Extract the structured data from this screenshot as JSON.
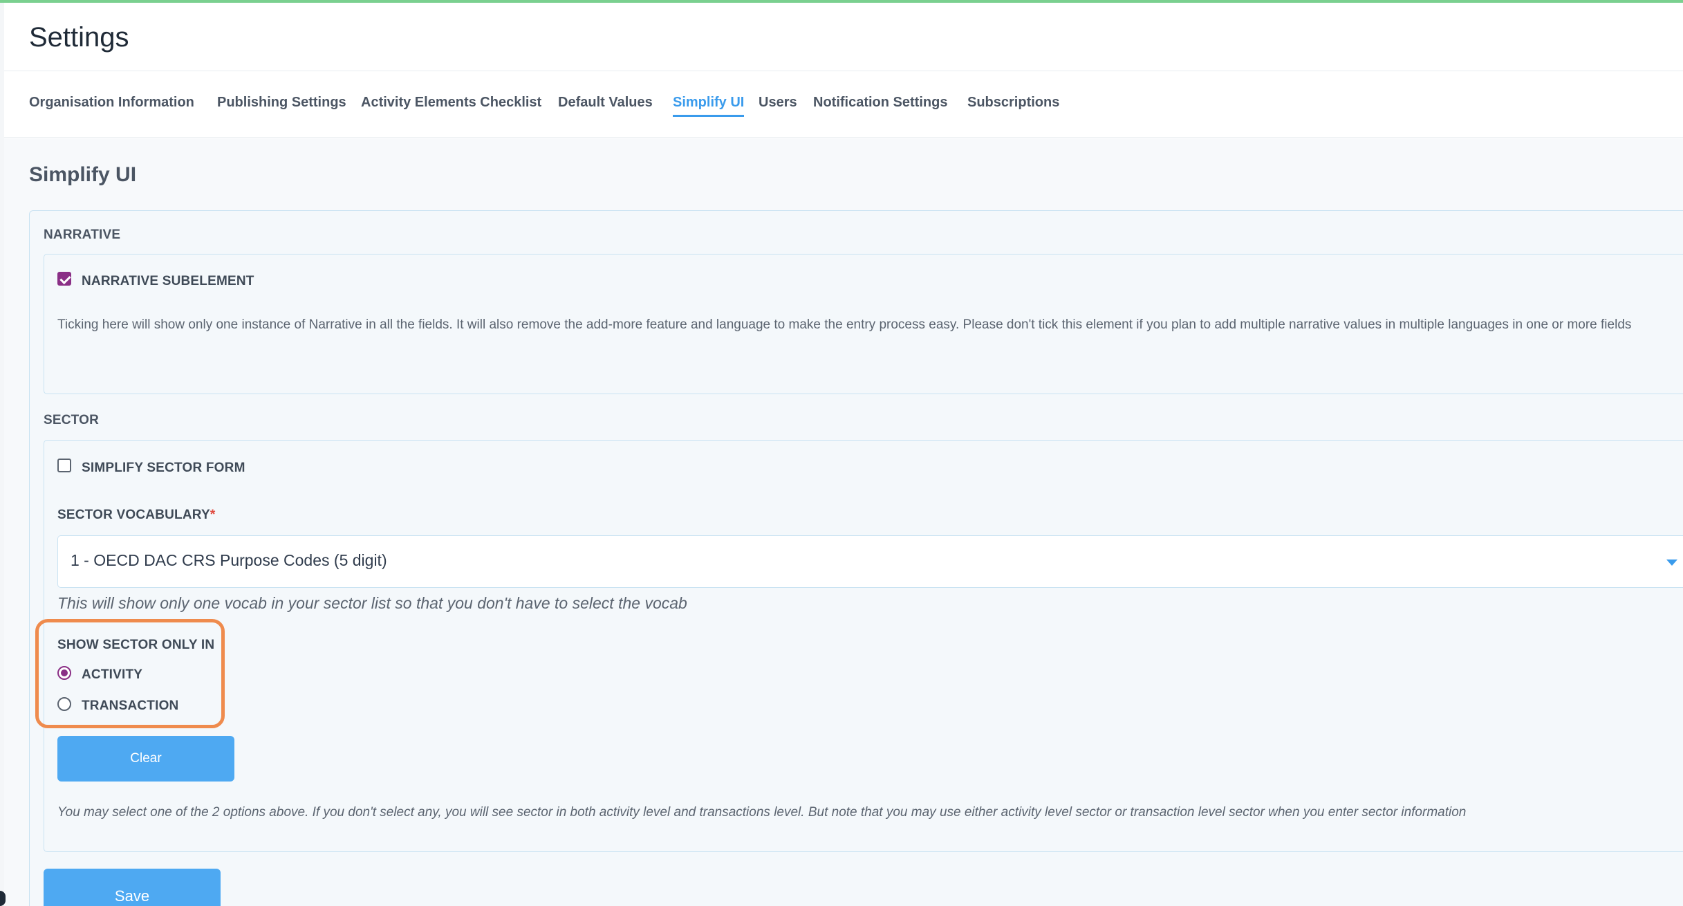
{
  "page": {
    "title": "Settings",
    "accent_color": "#7ad08f",
    "link_color": "#3a9bec",
    "check_color": "#8a2f86",
    "highlight_color": "#ef8b4d"
  },
  "tabs": [
    {
      "label": "Organisation Information",
      "active": false
    },
    {
      "label": "Publishing Settings",
      "active": false
    },
    {
      "label": "Activity Elements Checklist",
      "active": false
    },
    {
      "label": "Default Values",
      "active": false
    },
    {
      "label": "Simplify UI",
      "active": true
    },
    {
      "label": "Users",
      "active": false
    },
    {
      "label": "Notification Settings",
      "active": false
    },
    {
      "label": "Subscriptions",
      "active": false
    }
  ],
  "section": {
    "title": "Simplify UI"
  },
  "narrative": {
    "group_label": "NARRATIVE",
    "checkbox_label": "NARRATIVE SUBELEMENT",
    "checked": true,
    "description": "Ticking here will show only one instance of Narrative in all the fields. It will also remove the add-more feature and language to make the entry process easy. Please don't tick this element if you plan to add multiple narrative values in multiple languages in one or more fields"
  },
  "sector": {
    "group_label": "SECTOR",
    "simplify_label": "SIMPLIFY SECTOR FORM",
    "simplify_checked": false,
    "vocab_label": "SECTOR VOCABULARY",
    "required_mark": "*",
    "vocab_value": "1 - OECD DAC CRS Purpose Codes (5 digit)",
    "vocab_hint": "This will show only one vocab in your sector list so that you don't have to select the vocab",
    "show_only_label": "SHOW SECTOR ONLY IN",
    "options": [
      {
        "label": "ACTIVITY",
        "selected": true
      },
      {
        "label": "TRANSACTION",
        "selected": false
      }
    ],
    "clear_label": "Clear",
    "note": "You may select one of the 2 options above. If you don't select any, you will see sector in both activity level and transactions level. But note that you may use either activity level sector or transaction level sector when you enter sector information"
  },
  "actions": {
    "save_label": "Save"
  },
  "icons": {
    "checkbox_checked": "checkbox-checked-icon",
    "checkbox_unchecked": "checkbox-unchecked-icon",
    "dropdown": "chevron-down-icon",
    "radio_selected": "radio-selected-icon",
    "radio_unselected": "radio-unselected-icon"
  }
}
